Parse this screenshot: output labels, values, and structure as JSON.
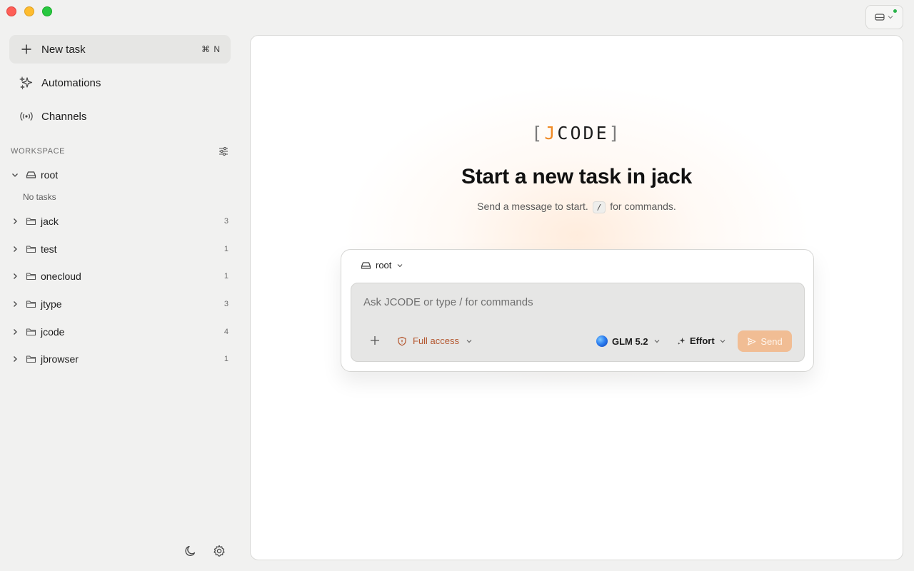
{
  "window": {
    "traffic_lights": [
      "close",
      "minimize",
      "zoom"
    ]
  },
  "sidebar": {
    "new_task": {
      "label": "New task",
      "shortcut": "⌘ N"
    },
    "automations": {
      "label": "Automations"
    },
    "channels": {
      "label": "Channels"
    },
    "workspace_label": "WORKSPACE",
    "root": {
      "label": "root",
      "empty_text": "No tasks"
    },
    "folders": [
      {
        "name": "jack",
        "count": "3"
      },
      {
        "name": "test",
        "count": "1"
      },
      {
        "name": "onecloud",
        "count": "1"
      },
      {
        "name": "jtype",
        "count": "3"
      },
      {
        "name": "jcode",
        "count": "4"
      },
      {
        "name": "jbrowser",
        "count": "1"
      }
    ]
  },
  "main": {
    "logo": {
      "open": "[",
      "j": "J",
      "rest": "CODE",
      "close": "]"
    },
    "headline": "Start a new task in jack",
    "subline_before": "Send a message to start.",
    "subline_key": "/",
    "subline_after": "for commands.",
    "composer": {
      "workspace": "root",
      "placeholder": "Ask JCODE or type / for commands",
      "access": "Full access",
      "model": "GLM 5.2",
      "effort": "Effort",
      "send": "Send"
    }
  },
  "colors": {
    "accent": "#f08a24",
    "send_button": "#f1bd94",
    "access_text": "#b4572f",
    "status_dot": "#29b34a"
  }
}
